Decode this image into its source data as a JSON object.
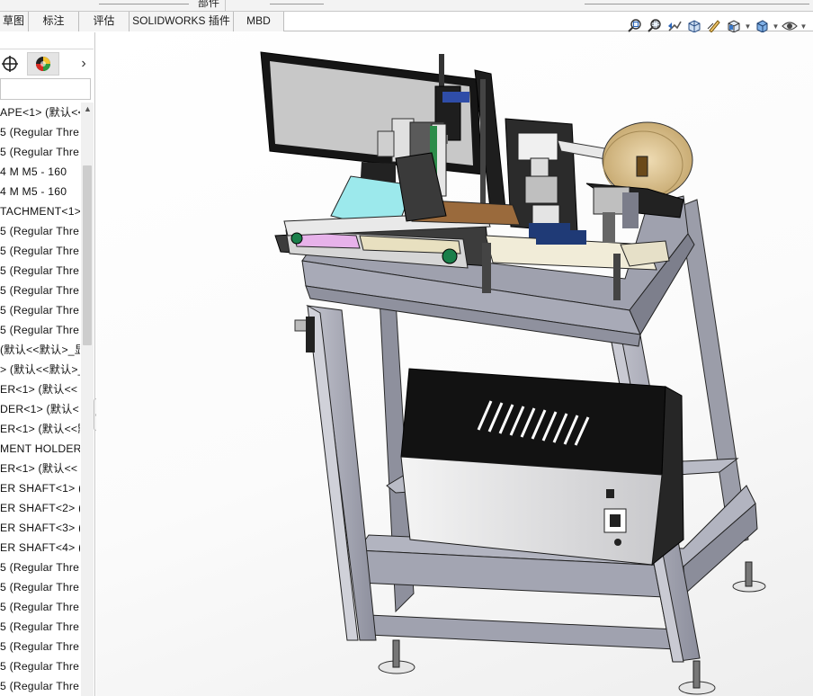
{
  "top_menu": {
    "cut_tab_label": "部件"
  },
  "tabs": [
    {
      "label": "草图",
      "id": "sketch"
    },
    {
      "label": "标注",
      "id": "markup"
    },
    {
      "label": "评估",
      "id": "evaluate"
    },
    {
      "label": "SOLIDWORKS 插件",
      "id": "addins"
    },
    {
      "label": "MBD",
      "id": "mbd"
    }
  ],
  "hud_icons": [
    "zoom-to-fit-icon",
    "zoom-to-area-icon",
    "previous-view-icon",
    "section-view-icon",
    "dynamic-annotation-icon",
    "view-orientation-icon",
    "display-style-icon",
    "hide-show-items-icon"
  ],
  "panel": {
    "tabs": [
      "feature-manager-icon",
      "property-manager-icon",
      "configuration-manager-icon",
      "dimxpert-icon",
      "display-manager-icon"
    ],
    "expand_arrow": "›",
    "filter_placeholder": ""
  },
  "tree_items": [
    "APE<1> (默认<<",
    "5  (Regular Thre",
    "5  (Regular Thre",
    "4  M M5  -  160",
    "4  M M5  -  160",
    "TACHMENT<1>",
    "5  (Regular Thre",
    "5  (Regular Thre",
    "5  (Regular Thre",
    "5  (Regular Thre",
    "5  (Regular Thre",
    "5  (Regular Thre",
    "(默认<<默认>_显",
    "> (默认<<默认>_",
    "ER<1> (默认<<",
    "DER<1> (默认<",
    "ER<1> (默认<<默",
    "MENT HOLDER",
    "ER<1> (默认<<",
    "ER SHAFT<1> (",
    "ER SHAFT<2> (",
    "ER SHAFT<3> (",
    "ER SHAFT<4> (",
    "5  (Regular Thre",
    "5  (Regular Thre",
    "5  (Regular Thre",
    "5  (Regular Thre",
    "5  (Regular Thre",
    "5  (Regular Thre",
    "5  (Regular Thre"
  ],
  "colors": {
    "frame": "#a9abb7",
    "frame_dark": "#7c7e8c",
    "enclosure": "#1b1b1b",
    "tape_reel": "#e6d2a8",
    "table_top": "#9fe8ea",
    "feeder_plate": "#9a6a3c",
    "feeder_pink": "#e7b2ea"
  }
}
